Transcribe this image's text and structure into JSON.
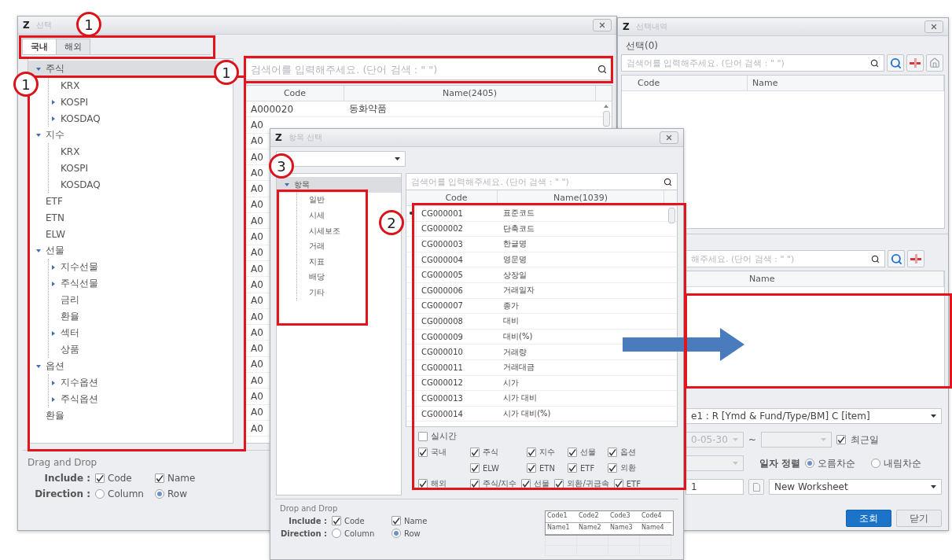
{
  "main_window": {
    "logo": "Z",
    "title": "선택",
    "tabs": [
      {
        "label": "국내",
        "selected": true
      },
      {
        "label": "해외",
        "selected": false
      }
    ],
    "tree": [
      {
        "label": "주식",
        "selected": true,
        "expanded": true,
        "children": [
          {
            "label": "KRX",
            "selected": false
          },
          {
            "label": "KOSPI",
            "selected": false,
            "expanded": false
          },
          {
            "label": "KOSDAQ",
            "selected": false,
            "expanded": false
          }
        ]
      },
      {
        "label": "지수",
        "selected": false,
        "expanded": true,
        "children": [
          {
            "label": "KRX",
            "selected": false
          },
          {
            "label": "KOSPI",
            "selected": false
          },
          {
            "label": "KOSDAQ",
            "selected": false
          }
        ]
      },
      {
        "label": "ETF",
        "selected": false
      },
      {
        "label": "ETN",
        "selected": false
      },
      {
        "label": "ELW",
        "selected": false
      },
      {
        "label": "선물",
        "selected": false,
        "expanded": true,
        "children": [
          {
            "label": "지수선물",
            "selected": false,
            "expanded": false
          },
          {
            "label": "주식선물",
            "selected": false,
            "expanded": false
          },
          {
            "label": "금리",
            "selected": false
          },
          {
            "label": "환율",
            "selected": false
          },
          {
            "label": "섹터",
            "selected": false,
            "expanded": false
          },
          {
            "label": "상품",
            "selected": false
          }
        ]
      },
      {
        "label": "옵션",
        "selected": false,
        "expanded": true,
        "children": [
          {
            "label": "지수옵션",
            "selected": false,
            "expanded": false
          },
          {
            "label": "주식옵션",
            "selected": false,
            "expanded": false
          }
        ]
      },
      {
        "label": "환율",
        "selected": false
      }
    ],
    "search": {
      "placeholder": "검색어를 입력해주세요. (단어 검색 : \" \")"
    },
    "table": {
      "columns": [
        "Code",
        "Name(2405)"
      ],
      "rows": [
        {
          "code": "A000020",
          "name": "동화약품"
        },
        {
          "code": "A0"
        },
        {
          "code": "A0"
        },
        {
          "code": "A0"
        },
        {
          "code": "A0"
        },
        {
          "code": "A0"
        },
        {
          "code": "A0"
        },
        {
          "code": "A0"
        },
        {
          "code": "A0"
        },
        {
          "code": "A0"
        },
        {
          "code": "A0"
        },
        {
          "code": "A0"
        },
        {
          "code": "A0"
        },
        {
          "code": "A0"
        },
        {
          "code": "A0"
        },
        {
          "code": "A0"
        },
        {
          "code": "A0"
        },
        {
          "code": "A0"
        },
        {
          "code": "A0"
        },
        {
          "code": "A0"
        },
        {
          "code": "A0"
        }
      ]
    },
    "drag_drop": {
      "legend": "Drag and Drop",
      "include_label": "Include :",
      "include": [
        {
          "label": "Code",
          "checked": true
        },
        {
          "label": "Name",
          "checked": true
        }
      ],
      "direction_label": "Direction :",
      "direction": [
        {
          "label": "Column",
          "selected": false
        },
        {
          "label": "Row",
          "selected": true
        }
      ]
    }
  },
  "selection_window": {
    "logo": "Z",
    "title": "선택내역",
    "section_label": "선택(0)",
    "search": {
      "placeholder": "검색어를 입력해주세요. (단어 검색 : \" \")"
    },
    "columns": [
      "Code",
      "Name"
    ],
    "lower_search": {
      "placeholder": "해주세요. (단어 검색 : \" \")"
    },
    "lower_columns": [
      "Name"
    ],
    "form": {
      "layout_select": "e1 : R [Ymd & Fund/Type/BM] C [item]",
      "date_from": "0-05-30",
      "range_sep": "~",
      "recent": {
        "label": "최근일",
        "checked": true
      },
      "sort_label": "일자 정렬",
      "sort": [
        {
          "label": "오름차순",
          "selected": true
        },
        {
          "label": "내림차순",
          "selected": false
        }
      ],
      "sheet_field": "1",
      "worksheet": "New Worksheet",
      "buttons": [
        {
          "label": "조회",
          "kind": "primary"
        },
        {
          "label": "닫기",
          "kind": "default"
        }
      ]
    }
  },
  "item_dialog": {
    "logo": "Z",
    "title": "항목 선택",
    "tree": [
      {
        "label": "항목",
        "selected": true,
        "expanded": true,
        "children": [
          {
            "label": "일반",
            "selected": false
          },
          {
            "label": "시세",
            "selected": false
          },
          {
            "label": "시세보조",
            "selected": false
          },
          {
            "label": "거래",
            "selected": false
          },
          {
            "label": "지표",
            "selected": false
          },
          {
            "label": "배당",
            "selected": false
          },
          {
            "label": "기타",
            "selected": false
          }
        ]
      }
    ],
    "search": {
      "placeholder": "검색어를 입력해주세요. (단어 검색 : \" \")"
    },
    "table": {
      "columns": [
        "Code",
        "Name(1039)"
      ],
      "rows": [
        {
          "code": "CG000001",
          "name": "표준코드",
          "current": true
        },
        {
          "code": "CG000002",
          "name": "단축코드",
          "current": false
        },
        {
          "code": "CG000003",
          "name": "한글명",
          "current": false
        },
        {
          "code": "CG000004",
          "name": "영문명",
          "current": false
        },
        {
          "code": "CG000005",
          "name": "상장일",
          "current": false
        },
        {
          "code": "CG000006",
          "name": "거래일자",
          "current": false
        },
        {
          "code": "CG000007",
          "name": "종가",
          "current": false
        },
        {
          "code": "CG000008",
          "name": "대비",
          "current": false
        },
        {
          "code": "CG000009",
          "name": "대비(%)",
          "current": false
        },
        {
          "code": "CG000010",
          "name": "거래량",
          "current": false
        },
        {
          "code": "CG000011",
          "name": "거래대금",
          "current": false
        },
        {
          "code": "CG000012",
          "name": "시가",
          "current": false
        },
        {
          "code": "CG000013",
          "name": "시가 대비",
          "current": false
        },
        {
          "code": "CG000014",
          "name": "시가 대비(%)",
          "current": false
        }
      ]
    },
    "realtime": {
      "label": "실시간",
      "checked": false
    },
    "groups": [
      {
        "label": "국내",
        "checked": true,
        "kind": "grid",
        "options": [
          {
            "label": "주식",
            "checked": true
          },
          {
            "label": "지수",
            "checked": true
          },
          {
            "label": "선물",
            "checked": true
          },
          {
            "label": "옵션",
            "checked": true
          },
          {
            "label": "ELW",
            "checked": true
          },
          {
            "label": "ETN",
            "checked": true
          },
          {
            "label": "ETF",
            "checked": true
          },
          {
            "label": "외환",
            "checked": true
          }
        ]
      },
      {
        "label": "해외",
        "checked": true,
        "kind": "inline",
        "options": [
          {
            "label": "주식/지수",
            "checked": true
          },
          {
            "label": "선물",
            "checked": true
          },
          {
            "label": "외환/귀금속",
            "checked": true
          },
          {
            "label": "ETF",
            "checked": true
          }
        ]
      }
    ],
    "drag_drop": {
      "legend": "Drop and Drop",
      "include_label": "Include :",
      "include": [
        {
          "label": "Code",
          "checked": true
        },
        {
          "label": "Name",
          "checked": true
        }
      ],
      "direction_label": "Direction :",
      "direction": [
        {
          "label": "Column",
          "selected": false
        },
        {
          "label": "Row",
          "selected": true
        }
      ]
    },
    "preview": [
      [
        "Code1",
        "Code2",
        "Code3",
        "Code4"
      ],
      [
        "Name1",
        "Name2",
        "Name3",
        "Name4"
      ]
    ]
  },
  "annotations": [
    {
      "kind": "circle",
      "label": "1"
    },
    {
      "kind": "circle",
      "label": "1"
    },
    {
      "kind": "circle",
      "label": "1"
    },
    {
      "kind": "circle",
      "label": "3"
    },
    {
      "kind": "circle",
      "label": "2"
    },
    {
      "kind": "frame"
    },
    {
      "kind": "frame"
    },
    {
      "kind": "frame"
    },
    {
      "kind": "frame"
    },
    {
      "kind": "frame"
    },
    {
      "kind": "frame"
    },
    {
      "kind": "arrow"
    }
  ]
}
